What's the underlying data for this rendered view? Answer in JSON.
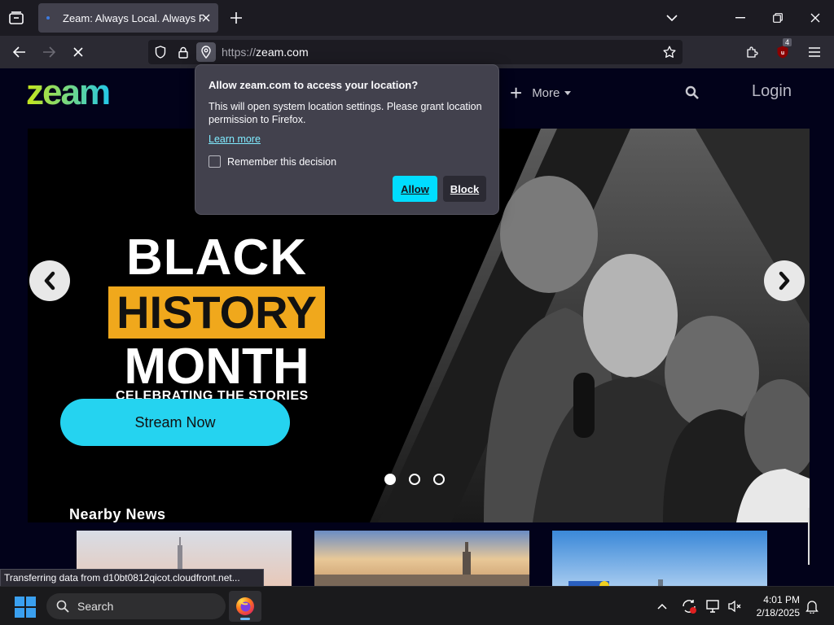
{
  "browser": {
    "tab": {
      "title": "Zeam: Always Local. Always Free"
    },
    "url": {
      "scheme": "https://",
      "host": "zeam.com"
    },
    "addon_badge": "4",
    "status": "Transferring data from d10bt0812qicot.cloudfront.net..."
  },
  "site": {
    "logo_text": "zeam",
    "nav": {
      "more_label": "More",
      "login_label": "Login"
    },
    "hero": {
      "title_line1": "BLACK",
      "title_line2": "HISTORY",
      "title_line3": "MONTH",
      "subtitle": "CELEBRATING THE STORIES",
      "cta_label": "Stream Now",
      "slides": 3,
      "active_slide": 1
    },
    "news": {
      "heading": "Nearby News"
    }
  },
  "permission_popup": {
    "title": "Allow zeam.com to access your location?",
    "body": "This will open system location settings. Please grant location permission to Firefox.",
    "learn_more": "Learn more",
    "remember_label": "Remember this decision",
    "remember_checked": false,
    "allow_label": "Allow",
    "block_label": "Block"
  },
  "taskbar": {
    "search_placeholder": "Search",
    "time": "4:01 PM",
    "date": "2/18/2025"
  },
  "colors": {
    "accent_cyan": "#25d3f0",
    "history_bar": "#f0a81c",
    "popup_allow": "#00ddff",
    "logo_gradient_start": "#c8e61a",
    "logo_gradient_end": "#23c8e8"
  }
}
